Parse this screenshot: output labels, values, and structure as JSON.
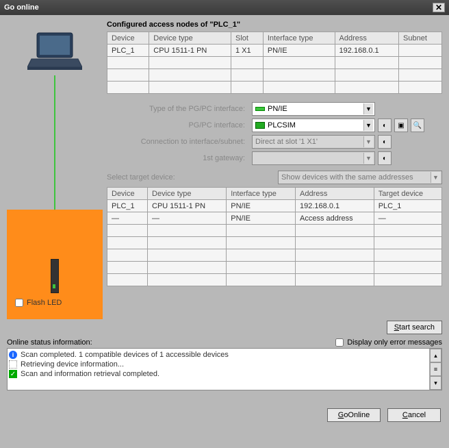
{
  "title": "Go online",
  "config_label": "Configured access nodes of \"PLC_1\"",
  "table1": {
    "headers": [
      "Device",
      "Device type",
      "Slot",
      "Interface type",
      "Address",
      "Subnet"
    ],
    "rows": [
      [
        "PLC_1",
        "CPU 1511-1 PN",
        "1 X1",
        "PN/IE",
        "192.168.0.1",
        ""
      ]
    ]
  },
  "form": {
    "type_lbl": "Type of the PG/PC interface:",
    "type_val": "PN/IE",
    "pgpc_lbl": "PG/PC interface:",
    "pgpc_val": "PLCSIM",
    "conn_lbl": "Connection to interface/subnet:",
    "conn_val": "Direct at slot '1 X1'",
    "gw_lbl": "1st gateway:",
    "gw_val": ""
  },
  "select_target_lbl": "Select target device:",
  "select_target_val": "Show devices with the same addresses",
  "table2": {
    "headers": [
      "Device",
      "Device type",
      "Interface type",
      "Address",
      "Target device"
    ],
    "rows": [
      [
        "PLC_1",
        "CPU 1511-1 PN",
        "PN/IE",
        "192.168.0.1",
        "PLC_1"
      ],
      [
        "—",
        "—",
        "PN/IE",
        "Access address",
        "—"
      ]
    ]
  },
  "flash_led": "Flash LED",
  "start_search": "Start search",
  "status_label": "Online status information:",
  "only_errors": "Display only error messages",
  "messages": {
    "m1": "Scan completed. 1 compatible devices of 1 accessible devices",
    "m2": "Retrieving device information...",
    "m3": "Scan and information retrieval completed."
  },
  "go_online": "GoOnline",
  "cancel": "Cancel"
}
